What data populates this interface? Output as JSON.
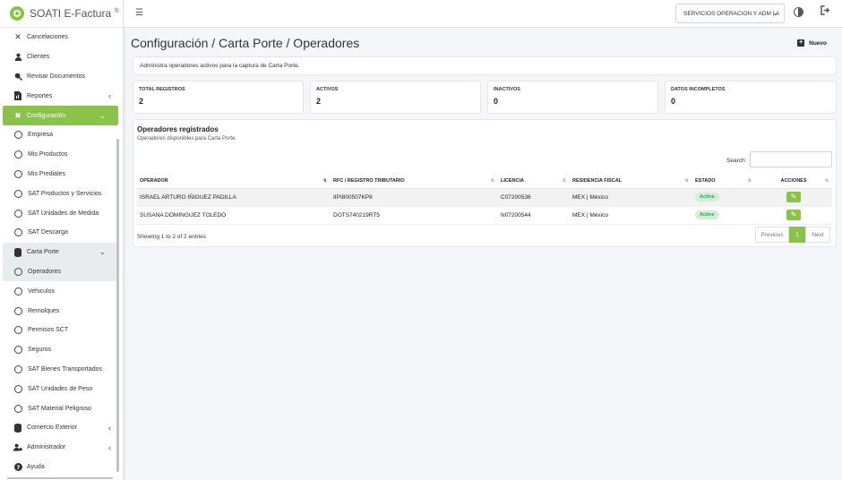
{
  "brand": {
    "name": "SOATI E-Factura",
    "mark": "®"
  },
  "header": {
    "company": "SERVICIOS OPERACION Y ADM | A"
  },
  "sidebar": {
    "items": [
      {
        "label": "Cancelaciones",
        "icon": "close-icon"
      },
      {
        "label": "Clientes",
        "icon": "user-icon"
      },
      {
        "label": "Revisar Documentos",
        "icon": "search-doc-icon"
      },
      {
        "label": "Reportes",
        "icon": "report-icon"
      },
      {
        "label": "Configuración",
        "icon": "tools-icon"
      },
      {
        "label": "Empresa"
      },
      {
        "label": "Mis Productos"
      },
      {
        "label": "Mis Prediales"
      },
      {
        "label": "SAT Productos y Servicios"
      },
      {
        "label": "SAT Unidades de Medida"
      },
      {
        "label": "SAT Descarga"
      },
      {
        "label": "Carta Porte",
        "icon": "database-icon"
      },
      {
        "label": "Operadores"
      },
      {
        "label": "Vehiculos"
      },
      {
        "label": "Remolques"
      },
      {
        "label": "Permisos SCT"
      },
      {
        "label": "Seguros"
      },
      {
        "label": "SAT Bienes Transportados"
      },
      {
        "label": "SAT Unidades de Peso"
      },
      {
        "label": "SAT Material Peligroso"
      },
      {
        "label": "Comercio Exterior",
        "icon": "database-icon"
      },
      {
        "label": "Administrador",
        "icon": "user-gear-icon"
      },
      {
        "label": "Ayuda",
        "icon": "help-icon"
      }
    ]
  },
  "page": {
    "title": "Configuración / Carta Porte / Operadores",
    "new_label": "Nuevo",
    "info": "Administra operadores activos para la captura de Carta Porte."
  },
  "stats": [
    {
      "label": "TOTAL REGISTROS",
      "value": "2"
    },
    {
      "label": "ACTIVOS",
      "value": "2"
    },
    {
      "label": "INACTIVOS",
      "value": "0"
    },
    {
      "label": "DATOS INCOMPLETOS",
      "value": "0"
    }
  ],
  "table": {
    "title": "Operadores registrados",
    "subtitle": "Operadores disponibles para Carta Porte.",
    "search_label": "Search:",
    "columns": [
      "OPERADOR",
      "RFC / REGISTRO TRIBUTARIO",
      "LICENCIA",
      "RESIDENCIA FISCAL",
      "ESTADO",
      "ACCIONES"
    ],
    "rows": [
      {
        "operador": "ISRAEL ARTURO IÑIGUEZ PADILLA",
        "rfc": "IIPI800507KP8",
        "licencia": "C07200536",
        "residencia": "MEX | México",
        "estado": "Active"
      },
      {
        "operador": "SUSANA DOMINGUEZ TOLEDO",
        "rfc": "DOTS740219RT5",
        "licencia": "N07200544",
        "residencia": "MEX | México",
        "estado": "Active"
      }
    ],
    "showing": "Showing 1 to 2 of 2 entries",
    "pager": {
      "prev": "Previous",
      "page": "1",
      "next": "Next"
    }
  }
}
